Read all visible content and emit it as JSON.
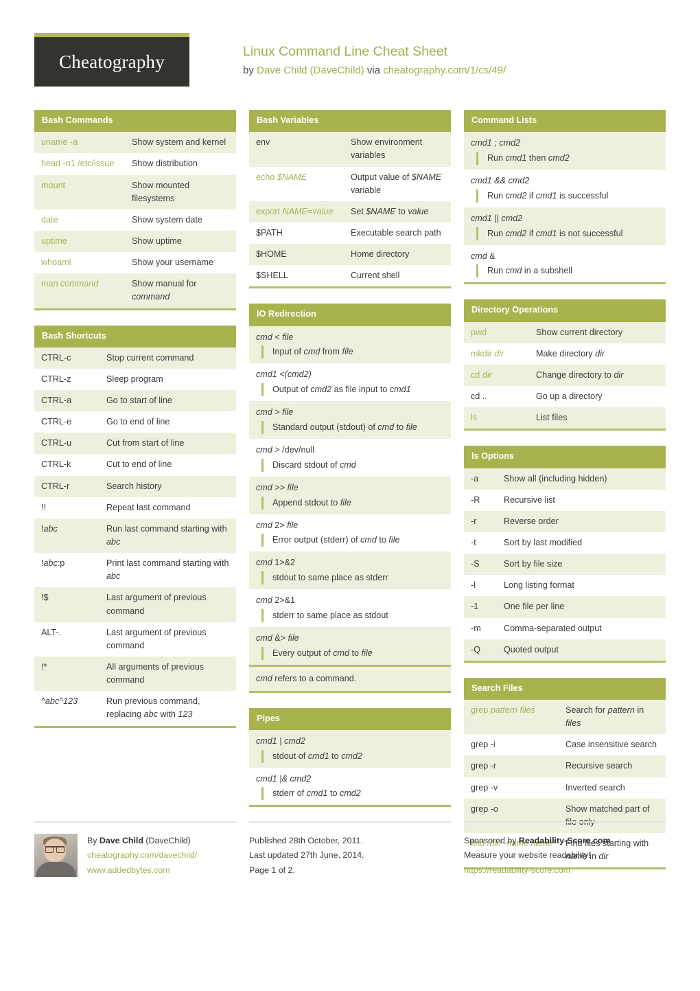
{
  "header": {
    "logo": "Cheatography",
    "title": "Linux Command Line Cheat Sheet",
    "by_prefix": "by ",
    "author": "Dave Child (DaveChild)",
    "via": " via ",
    "url": "cheatography.com/1/cs/49/"
  },
  "colors": {
    "accent_green": "#a9b34e",
    "row_stripe": "#eef0dd",
    "link_green": "#a4ae4c",
    "logo_bg": "#333330",
    "border_green": "#b4bd6b"
  },
  "sections": {
    "bash_commands": {
      "title": "Bash Commands",
      "rows": [
        {
          "k": "uname -a",
          "v": "Show system and kernel"
        },
        {
          "k": "head -n1 /etc/issue",
          "v": "Show distribution"
        },
        {
          "k": "mount",
          "v": "Show mounted filesystems"
        },
        {
          "k": "date",
          "v": "Show system date"
        },
        {
          "k": "uptime",
          "v": "Show uptime"
        },
        {
          "k": "whoami",
          "v": "Show your username"
        },
        {
          "k": "man command",
          "v": "Show manual for command"
        }
      ]
    },
    "bash_shortcuts": {
      "title": "Bash Shortcuts",
      "rows": [
        {
          "k": "CTRL-c",
          "v": "Stop current command"
        },
        {
          "k": "CTRL-z",
          "v": "Sleep program"
        },
        {
          "k": "CTRL-a",
          "v": "Go to start of line"
        },
        {
          "k": "CTRL-e",
          "v": "Go to end of line"
        },
        {
          "k": "CTRL-u",
          "v": "Cut from start of line"
        },
        {
          "k": "CTRL-k",
          "v": "Cut to end of line"
        },
        {
          "k": "CTRL-r",
          "v": "Search history"
        },
        {
          "k": "!!",
          "v": "Repeat last command"
        },
        {
          "k": "!abc",
          "v": "Run last command starting with abc"
        },
        {
          "k": "!abc:p",
          "v": "Print last command starting with abc"
        },
        {
          "k": "!$",
          "v": "Last argument of previous command"
        },
        {
          "k": "ALT-.",
          "v": "Last argument of previous command"
        },
        {
          "k": "!*",
          "v": "All arguments of previous command"
        },
        {
          "k": "^abc^123",
          "v": "Run previous command, replacing abc with 123"
        }
      ]
    },
    "bash_variables": {
      "title": "Bash Variables",
      "rows": [
        {
          "k": "env",
          "v": "Show environment variables"
        },
        {
          "k": "echo $NAME",
          "v": "Output value of $NAME variable"
        },
        {
          "k": "export NAME=value",
          "v": "Set $NAME to value"
        },
        {
          "k": "$PATH",
          "v": "Executable search path"
        },
        {
          "k": "$HOME",
          "v": "Home directory"
        },
        {
          "k": "$SHELL",
          "v": "Current shell"
        }
      ]
    },
    "io_redirection": {
      "title": "IO Redirection",
      "rows": [
        {
          "code": "cmd < file",
          "note": "Input of cmd from file"
        },
        {
          "code": "cmd1 <(cmd2)",
          "note": "Output of cmd2 as file input to cmd1"
        },
        {
          "code": "cmd > file",
          "note": "Standard output (stdout) of cmd to file"
        },
        {
          "code": "cmd > /dev/null",
          "note": "Discard stdout of cmd"
        },
        {
          "code": "cmd >> file",
          "note": "Append stdout to file"
        },
        {
          "code": "cmd 2> file",
          "note": "Error output (stderr) of cmd to file"
        },
        {
          "code": "cmd 1>&2",
          "note": "stdout to same place as stderr"
        },
        {
          "code": "cmd 2>&1",
          "note": "stderr to same place as stdout"
        },
        {
          "code": "cmd &> file",
          "note": "Every output of cmd to file"
        }
      ],
      "footnote": "cmd refers to a command."
    },
    "pipes": {
      "title": "Pipes",
      "rows": [
        {
          "code": "cmd1 | cmd2",
          "note": "stdout of cmd1 to cmd2"
        },
        {
          "code": "cmd1 |& cmd2",
          "note": "stderr of cmd1 to cmd2"
        }
      ]
    },
    "command_lists": {
      "title": "Command Lists",
      "rows": [
        {
          "code": "cmd1 ; cmd2",
          "note": "Run cmd1 then cmd2"
        },
        {
          "code": "cmd1 && cmd2",
          "note": "Run cmd2 if cmd1 is successful"
        },
        {
          "code": "cmd1 || cmd2",
          "note": "Run cmd2 if cmd1 is not successful"
        },
        {
          "code": "cmd &",
          "note": "Run cmd in a subshell"
        }
      ]
    },
    "directory_operations": {
      "title": "Directory Operations",
      "rows": [
        {
          "k": "pwd",
          "v": "Show current directory"
        },
        {
          "k": "mkdir dir",
          "v": "Make directory dir"
        },
        {
          "k": "cd dir",
          "v": "Change directory to dir"
        },
        {
          "k": "cd ..",
          "v": "Go up a directory"
        },
        {
          "k": "ls",
          "v": "List files"
        }
      ]
    },
    "ls_options": {
      "title": "ls Options",
      "rows": [
        {
          "k": "-a",
          "v": "Show all (including hidden)"
        },
        {
          "k": "-R",
          "v": "Recursive list"
        },
        {
          "k": "-r",
          "v": "Reverse order"
        },
        {
          "k": "-t",
          "v": "Sort by last modified"
        },
        {
          "k": "-S",
          "v": "Sort by file size"
        },
        {
          "k": "-l",
          "v": "Long listing format"
        },
        {
          "k": "-1",
          "v": "One file per line"
        },
        {
          "k": "-m",
          "v": "Comma-separated output"
        },
        {
          "k": "-Q",
          "v": "Quoted output"
        }
      ]
    },
    "search_files": {
      "title": "Search Files",
      "rows": [
        {
          "k": "grep pattern files",
          "v": "Search for pattern in files"
        },
        {
          "k": "grep -i",
          "v": "Case insensitive search"
        },
        {
          "k": "grep -r",
          "v": "Recursive search"
        },
        {
          "k": "grep -v",
          "v": "Inverted search"
        },
        {
          "k": "grep -o",
          "v": "Show matched part of file only"
        },
        {
          "k": "find /dir/ -name name*",
          "v": "Find files starting with name in dir"
        }
      ]
    }
  },
  "footer": {
    "author_line_prefix": "By ",
    "author_name": "Dave Child",
    "author_handle": " (DaveChild)",
    "author_url": "cheatography.com/davechild/",
    "author_site": "www.addedbytes.com",
    "published": "Published 28th October, 2011.",
    "updated": "Last updated 27th June, 2014.",
    "page": "Page 1 of 2.",
    "sponsor_prefix": "Sponsored by ",
    "sponsor_name": "Readability-Score.com",
    "sponsor_tagline": "Measure your website readability!",
    "sponsor_url": "https://readability-score.com"
  }
}
